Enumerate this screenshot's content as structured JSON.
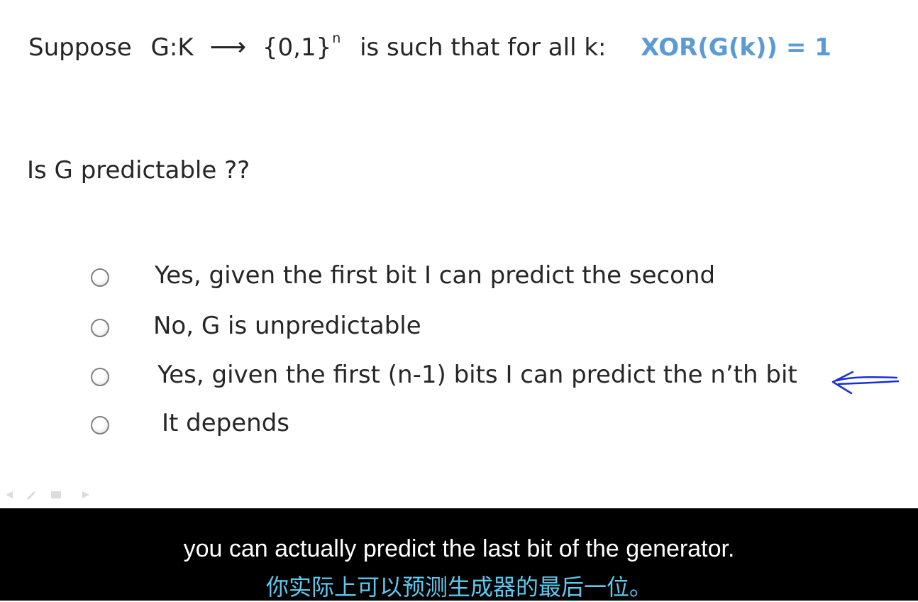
{
  "slide": {
    "line1": {
      "suppose": "Suppose",
      "g_map": "G:K",
      "arrow": "⟶",
      "set": "{0,1}",
      "set_exponent": "n",
      "condition": "is such that for all k:",
      "highlight": "XOR(G(k)) = 1",
      "highlight_color": "#5b9bd5"
    },
    "question": "Is G predictable ??",
    "options": [
      {
        "label": "Yes, given the first bit I can predict the second"
      },
      {
        "label": "No, G is unpredictable"
      },
      {
        "label": "Yes, given the first (n-1) bits I can predict the n’th bit"
      },
      {
        "label": "It depends"
      }
    ],
    "annotation": {
      "icon": "hand-drawn-arrow-icon",
      "color": "#1a2fd6"
    }
  },
  "subtitles": {
    "english": "you can actually predict the last bit of the generator.",
    "chinese": "你实际上可以预测生成器的最后一位。",
    "chinese_color": "#5ec8ee"
  }
}
